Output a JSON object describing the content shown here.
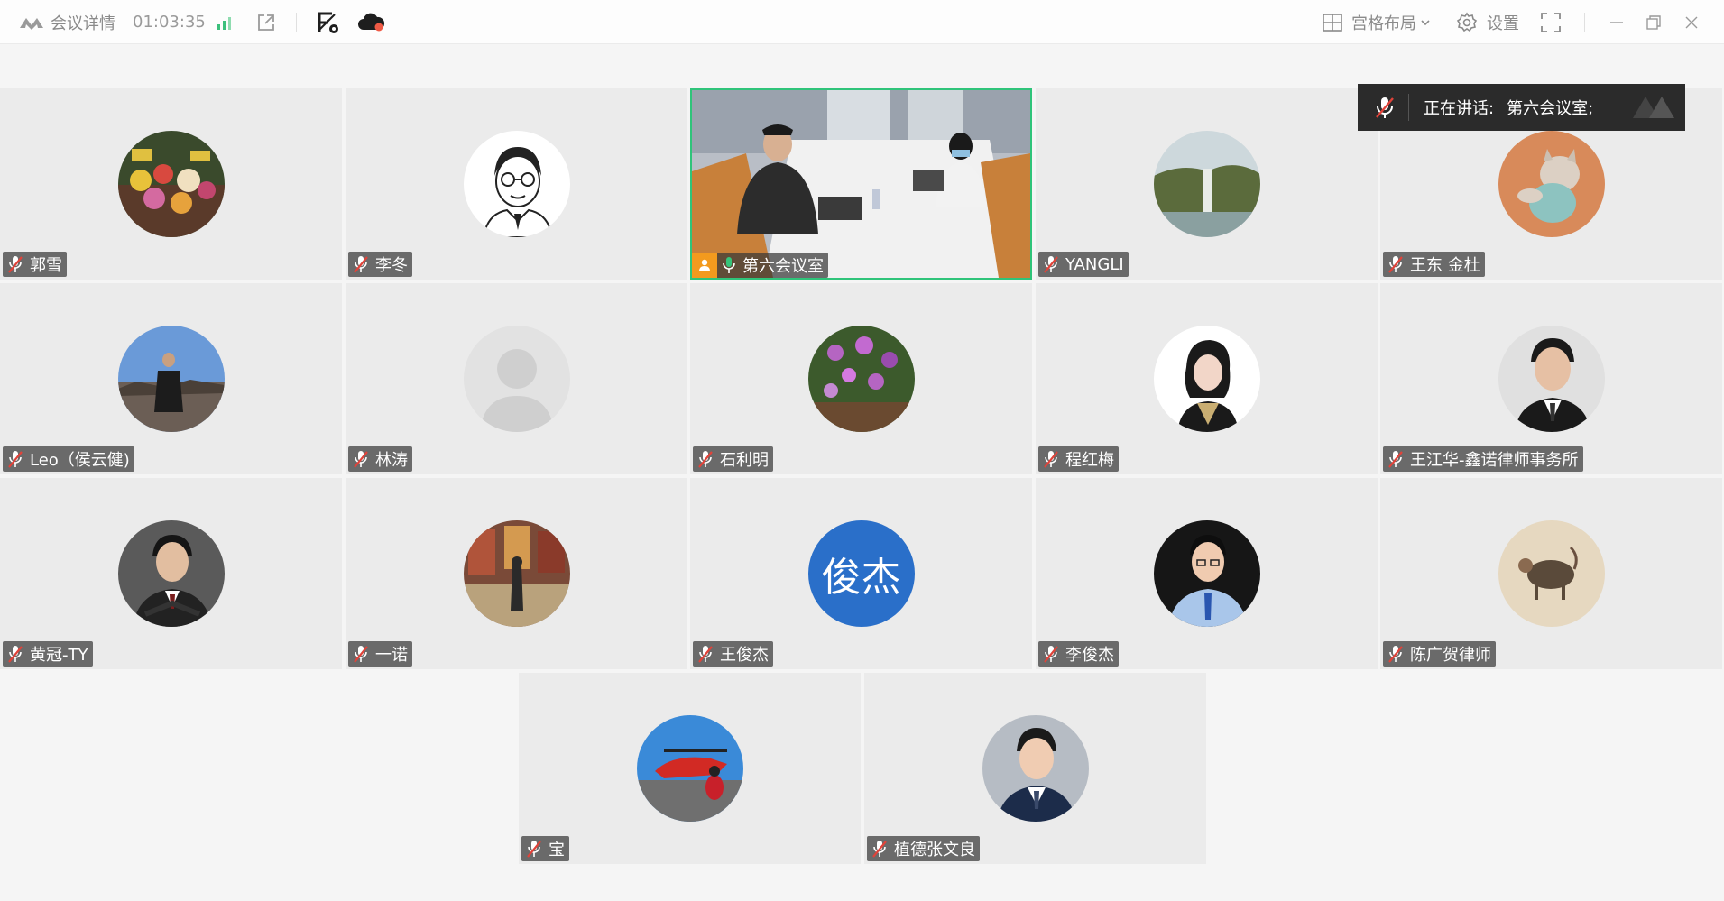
{
  "topbar": {
    "meeting_details_label": "会议详情",
    "duration": "01:03:35",
    "layout_label": "宫格布局",
    "settings_label": "设置"
  },
  "speaking": {
    "prefix": "正在讲话:",
    "speaker": "第六会议室;"
  },
  "participants": [
    {
      "name": "郭雪",
      "avatar": "flowers-photo"
    },
    {
      "name": "李冬",
      "avatar": "cartoon-portrait"
    },
    {
      "name": "第六会议室",
      "avatar": "video-feed",
      "active": true
    },
    {
      "name": "YANGLI",
      "avatar": "waterfall-photo"
    },
    {
      "name": "王东 金杜",
      "avatar": "cat-photo"
    },
    {
      "name": "Leo（侯云健)",
      "avatar": "outdoor-portrait"
    },
    {
      "name": "林涛",
      "avatar": "default-silhouette"
    },
    {
      "name": "石利明",
      "avatar": "orchid-photo"
    },
    {
      "name": "程红梅",
      "avatar": "woman-portrait"
    },
    {
      "name": "王江华-鑫诺律师事务所",
      "avatar": "man-portrait"
    },
    {
      "name": "黄冠-TY",
      "avatar": "man-portrait-dark"
    },
    {
      "name": "一诺",
      "avatar": "gallery-photo"
    },
    {
      "name": "王俊杰",
      "avatar": "text-avatar",
      "avatar_text": "俊杰"
    },
    {
      "name": "李俊杰",
      "avatar": "man-blue-shirt"
    },
    {
      "name": "陈广贺律师",
      "avatar": "painting-photo"
    },
    {
      "name": "宝",
      "avatar": "helicopter-photo"
    },
    {
      "name": "植德张文良",
      "avatar": "man-suit-portrait"
    }
  ],
  "colors": {
    "active_border": "#2fc47a",
    "text_avatar_bg": "#2a6fc9",
    "mute_red": "#e0433a"
  }
}
